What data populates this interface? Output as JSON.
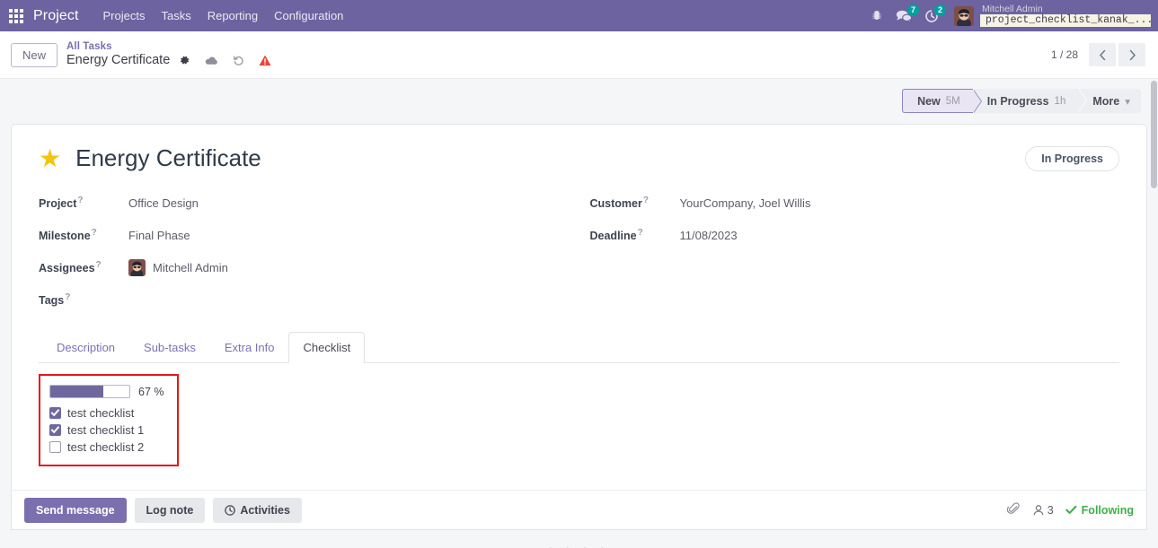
{
  "navbar": {
    "apps_icon": "apps-grid-icon",
    "brand": "Project",
    "menus": [
      {
        "label": "Projects"
      },
      {
        "label": "Tasks"
      },
      {
        "label": "Reporting"
      },
      {
        "label": "Configuration"
      }
    ],
    "bug_icon": "bug-icon",
    "messages_icon": "messages-icon",
    "messages_count": "7",
    "activities_icon": "activities-clock-icon",
    "activities_count": "2",
    "avatar_icon": "user-avatar",
    "user_name": "Mitchell Admin",
    "database": "project_checklist_kanak_...",
    "db_icon": "database-icon"
  },
  "controlpanel": {
    "new_label": "New",
    "breadcrumb_parent": "All Tasks",
    "breadcrumb_current": "Energy Certificate",
    "gear_icon": "gear-icon",
    "save_icon": "cloud-save-icon",
    "discard_icon": "undo-discard-icon",
    "warning_icon": "warning-triangle-icon",
    "pager": "1 / 28",
    "prev_icon": "chevron-left-icon",
    "next_icon": "chevron-right-icon"
  },
  "statusbar": {
    "stages": [
      {
        "label": "New",
        "duration": "5M",
        "active": true
      },
      {
        "label": "In Progress",
        "duration": "1h",
        "active": false
      },
      {
        "label": "More",
        "duration": "",
        "active": false,
        "caret": "▾"
      }
    ]
  },
  "record": {
    "favorite_icon": "star-icon",
    "title": "Energy Certificate",
    "kanban_state": "In Progress",
    "fields_left": [
      {
        "label": "Project",
        "value": "Office Design",
        "help": "?"
      },
      {
        "label": "Milestone",
        "value": "Final Phase",
        "help": "?"
      },
      {
        "label": "Assignees",
        "value": "Mitchell Admin",
        "help": "?",
        "avatar": true
      },
      {
        "label": "Tags",
        "value": "",
        "help": "?"
      }
    ],
    "fields_right": [
      {
        "label": "Customer",
        "value": "YourCompany, Joel Willis",
        "help": "?"
      },
      {
        "label": "Deadline",
        "value": "11/08/2023",
        "help": "?"
      }
    ]
  },
  "tabs": [
    {
      "label": "Description",
      "active": false
    },
    {
      "label": "Sub-tasks",
      "active": false
    },
    {
      "label": "Extra Info",
      "active": false
    },
    {
      "label": "Checklist",
      "active": true
    }
  ],
  "checklist": {
    "highlight_color": "#e8141b",
    "progress_percent": 67,
    "progress_label": "67 %",
    "items": [
      {
        "label": "test checklist",
        "checked": true
      },
      {
        "label": "test checklist 1",
        "checked": true
      },
      {
        "label": "test checklist 2",
        "checked": false
      }
    ]
  },
  "chatter": {
    "send_message": "Send message",
    "log_note": "Log note",
    "activities": "Activities",
    "activities_icon": "clock-icon",
    "attachment_icon": "paperclip-icon",
    "followers_icon": "followers-person-icon",
    "followers_count": "3",
    "following_label": "Following",
    "following_check_icon": "check-icon"
  },
  "colors": {
    "navbar": "#6C63A0",
    "primary": "#7c6fae",
    "progress_fill": "#6f689f",
    "star": "#f1c40f",
    "following": "#3fae49",
    "badge": "#00a09d",
    "highlight": "#e8141b"
  }
}
